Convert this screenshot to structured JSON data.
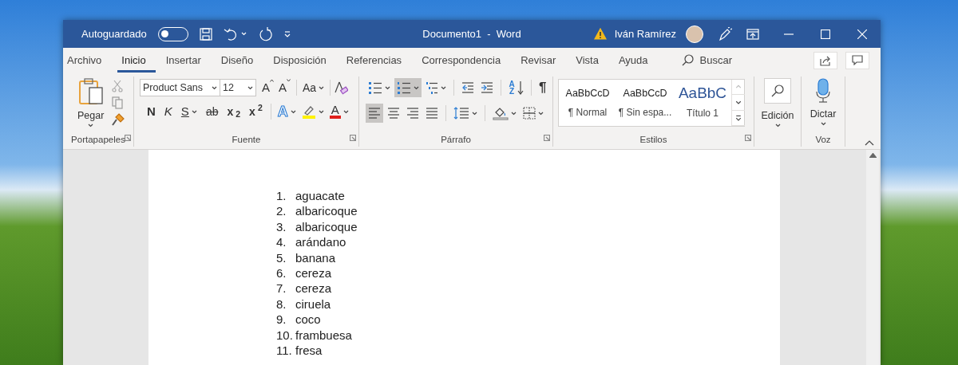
{
  "title_bar": {
    "autosave_label": "Autoguardado",
    "autosave_on": false,
    "document_title": "Documento1  -  Word",
    "user_name": "Iván Ramírez"
  },
  "menu_tabs": [
    {
      "label": "Archivo",
      "selected": false
    },
    {
      "label": "Inicio",
      "selected": true
    },
    {
      "label": "Insertar",
      "selected": false
    },
    {
      "label": "Diseño",
      "selected": false
    },
    {
      "label": "Disposición",
      "selected": false
    },
    {
      "label": "Referencias",
      "selected": false
    },
    {
      "label": "Correspondencia",
      "selected": false
    },
    {
      "label": "Revisar",
      "selected": false
    },
    {
      "label": "Vista",
      "selected": false
    },
    {
      "label": "Ayuda",
      "selected": false
    }
  ],
  "search": {
    "label": "Buscar"
  },
  "clipboard": {
    "paste_label": "Pegar",
    "group_label": "Portapapeles"
  },
  "font": {
    "font_name": "Product Sans",
    "font_size": "12",
    "grow_label": "A",
    "shrink_label": "A",
    "case_label": "Aa",
    "format_buttons": [
      {
        "kind": "bold",
        "label": "N",
        "dropdown": false
      },
      {
        "kind": "italic",
        "label": "K",
        "dropdown": false
      },
      {
        "kind": "underline",
        "label": "S",
        "dropdown": true
      },
      {
        "kind": "strike",
        "label": "ab",
        "dropdown": false
      },
      {
        "kind": "subscript",
        "label": "x$_{2}$",
        "dropdown": false
      },
      {
        "kind": "superscript",
        "label": "x$^{2}$",
        "dropdown": false
      }
    ],
    "effects_label": "A",
    "color_label": "A",
    "group_label": "Fuente"
  },
  "paragraph": {
    "row_1": [
      {
        "kind": "bullets",
        "selected": false,
        "dropdown": true
      },
      {
        "kind": "numbering",
        "selected": true,
        "dropdown": true
      },
      {
        "kind": "multilevel",
        "selected": false,
        "dropdown": true
      },
      {
        "kind": "outdent",
        "selected": false,
        "dropdown": false
      },
      {
        "kind": "indent",
        "selected": false,
        "dropdown": false
      },
      {
        "kind": "sort",
        "label": "AZ",
        "selected": false,
        "dropdown": false
      },
      {
        "kind": "marks",
        "label": "¶",
        "selected": false,
        "dropdown": false
      }
    ],
    "row_2": [
      {
        "kind": "left",
        "selected": true,
        "dropdown": false
      },
      {
        "kind": "center",
        "selected": false,
        "dropdown": false
      },
      {
        "kind": "right",
        "selected": false,
        "dropdown": false
      },
      {
        "kind": "justify",
        "selected": false,
        "dropdown": false
      },
      {
        "kind": "spacing",
        "selected": false,
        "dropdown": true
      },
      {
        "kind": "shading",
        "selected": false,
        "dropdown": true
      },
      {
        "kind": "borders",
        "selected": false,
        "dropdown": true
      }
    ],
    "group_label": "Párrafo"
  },
  "styles": {
    "items": [
      {
        "kind": "normal",
        "preview": "AaBbCcD",
        "name": "¶ Normal"
      },
      {
        "kind": "normal",
        "preview": "AaBbCcD",
        "name": "¶ Sin espa..."
      },
      {
        "kind": "heading",
        "preview": "AaBbC",
        "name": "Título 1"
      }
    ],
    "group_label": "Estilos"
  },
  "editing": {
    "label": "Edición"
  },
  "voice": {
    "label": "Dictar",
    "group_label": "Voz"
  },
  "document": {
    "list": [
      {
        "number": "1.",
        "text": "aguacate"
      },
      {
        "number": "2.",
        "text": "albaricoque"
      },
      {
        "number": "3.",
        "text": "albaricoque"
      },
      {
        "number": "4.",
        "text": "arándano"
      },
      {
        "number": "5.",
        "text": "banana"
      },
      {
        "number": "6.",
        "text": "cereza"
      },
      {
        "number": "7.",
        "text": "cereza"
      },
      {
        "number": "8.",
        "text": "ciruela"
      },
      {
        "number": "9.",
        "text": "coco"
      },
      {
        "number": "10.",
        "text": "frambuesa"
      },
      {
        "number": "11.",
        "text": "fresa"
      }
    ]
  }
}
